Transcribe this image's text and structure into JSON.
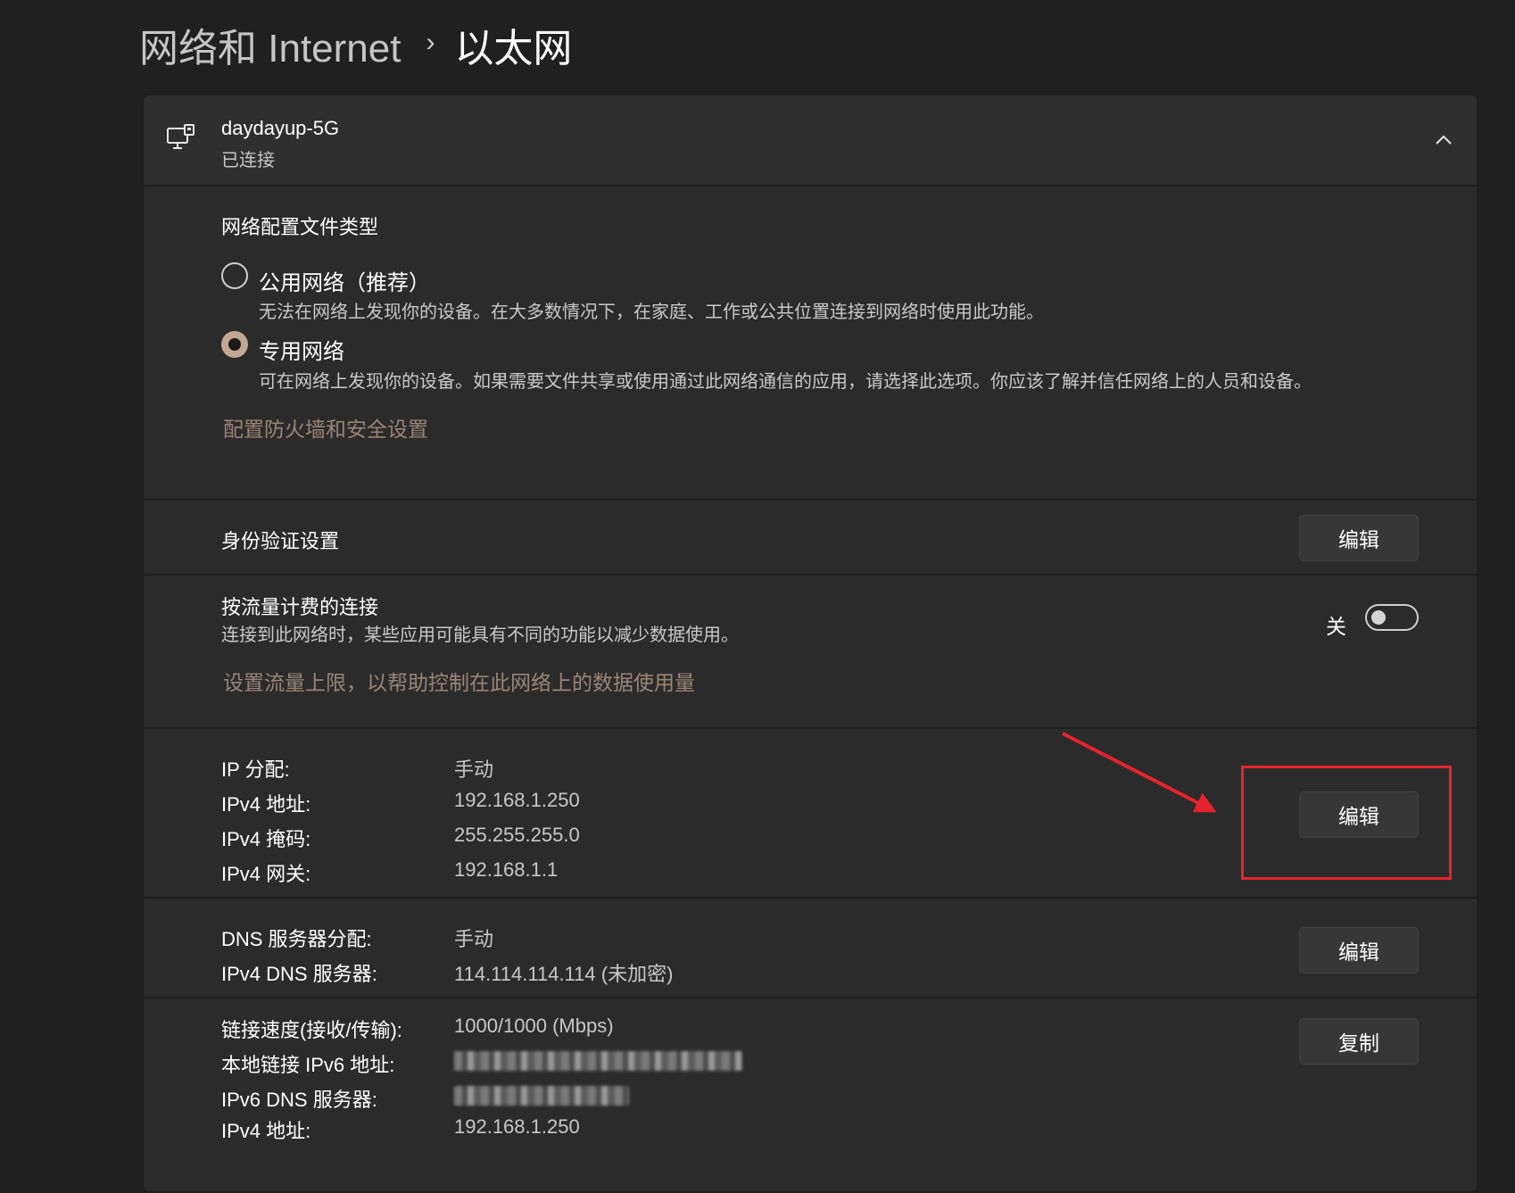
{
  "breadcrumb": {
    "parent": "网络和 Internet",
    "separator": "›",
    "current": "以太网"
  },
  "network": {
    "name": "daydayup-5G",
    "status": "已连接",
    "icon": "ethernet-monitor-icon",
    "expanded": true
  },
  "profile": {
    "heading": "网络配置文件类型",
    "options": [
      {
        "title": "公用网络（推荐）",
        "description": "无法在网络上发现你的设备。在大多数情况下，在家庭、工作或公共位置连接到网络时使用此功能。",
        "selected": false
      },
      {
        "title": "专用网络",
        "description": "可在网络上发现你的设备。如果需要文件共享或使用通过此网络通信的应用，请选择此选项。你应该了解并信任网络上的人员和设备。",
        "selected": true
      }
    ],
    "firewall_link": "配置防火墙和安全设置"
  },
  "auth": {
    "label": "身份验证设置",
    "button": "编辑"
  },
  "metered": {
    "label": "按流量计费的连接",
    "description": "连接到此网络时，某些应用可能具有不同的功能以减少数据使用。",
    "toggle_label": "关",
    "toggle_on": false,
    "data_limit_link": "设置流量上限，以帮助控制在此网络上的数据使用量"
  },
  "ip": {
    "rows": [
      {
        "key": "IP 分配:",
        "value": "手动"
      },
      {
        "key": "IPv4 地址:",
        "value": "192.168.1.250"
      },
      {
        "key": "IPv4 掩码:",
        "value": "255.255.255.0"
      },
      {
        "key": "IPv4 网关:",
        "value": "192.168.1.1"
      }
    ],
    "button": "编辑"
  },
  "dns": {
    "rows": [
      {
        "key": "DNS 服务器分配:",
        "value": "手动"
      },
      {
        "key": "IPv4 DNS 服务器:",
        "value": "114.114.114.114 (未加密)"
      }
    ],
    "button": "编辑"
  },
  "properties": {
    "rows": [
      {
        "key": "链接速度(接收/传输):",
        "value": "1000/1000 (Mbps)"
      },
      {
        "key": "本地链接 IPv6 地址:",
        "value": ""
      },
      {
        "key": "IPv6 DNS 服务器:",
        "value": ""
      },
      {
        "key": "IPv4 地址:",
        "value": "192.168.1.250"
      }
    ],
    "button": "复制"
  },
  "annotation": {
    "color": "#e6232d"
  },
  "colors": {
    "background": "#202020",
    "card": "#2b2b2b",
    "accent": "#c2a892",
    "link": "#9b8574"
  }
}
